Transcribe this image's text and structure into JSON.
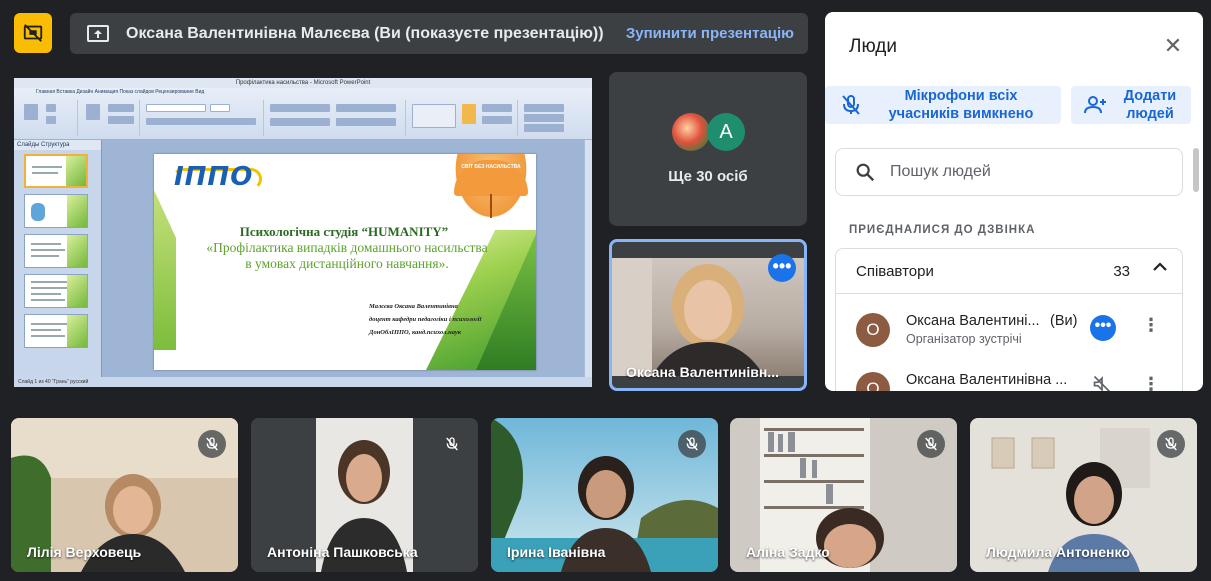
{
  "banner": {
    "presenter_text": "Оксана Валентинівна Малєєва (Ви (показуєте презентацію))",
    "stop_label": "Зупинити презентацію"
  },
  "presentation": {
    "window_title": "Профілактика насильства - Microsoft PowerPoint",
    "ribbon_tabs": "Главная   Вставка   Дизайн   Анимация   Показ слайдов   Рецензирование   Вид",
    "pane_tabs": "Слайды   Структура",
    "status_text": "Слайд 1 из 40   \"Грань\"   русский",
    "slide": {
      "logo": "ІППО",
      "umbrella_text": "СВІТ БЕЗ НАСИЛЬСТВА",
      "heading": "Психологічна студія “HUMANITY”",
      "subtitle": "«Профілактика випадків домашнього насильства в умовах дистанційного навчання».",
      "author_lines": [
        "Малєєва Оксана Валентинівна",
        "доцент кафедри педагогіки і психології",
        "ДонОблІППО, канд.психол.наук"
      ]
    }
  },
  "more_tile": {
    "label": "Ще 30 осіб",
    "avatar_letter": "A"
  },
  "self_tile": {
    "name": "Оксана Валентинівн..."
  },
  "people_panel": {
    "title": "Люди",
    "mute_all_label": "Мікрофони всіх учасників вимкнено",
    "add_people_label": "Додати людей",
    "search_placeholder": "Пошук людей",
    "section_title": "ПРИЄДНАЛИСЯ ДО ДЗВІНКА",
    "group_name": "Співавтори",
    "group_count": "33",
    "participants": [
      {
        "initial": "О",
        "name": "Оксана Валентині...",
        "you": "(Ви)",
        "role": "Організатор зустрічі"
      },
      {
        "initial": "О",
        "name": "Оксана Валентинівна ..."
      }
    ]
  },
  "bottom_tiles": [
    {
      "name": "Лілія Верховець"
    },
    {
      "name": "Антоніна Пашковська"
    },
    {
      "name": "Ірина Іванівна"
    },
    {
      "name": "Аліна Задко"
    },
    {
      "name": "Людмила Антоненко"
    }
  ],
  "colors": {
    "accent": "#8ab4f8",
    "blue": "#1a73e8",
    "present_yellow": "#fbbc04",
    "bg": "#202124"
  }
}
